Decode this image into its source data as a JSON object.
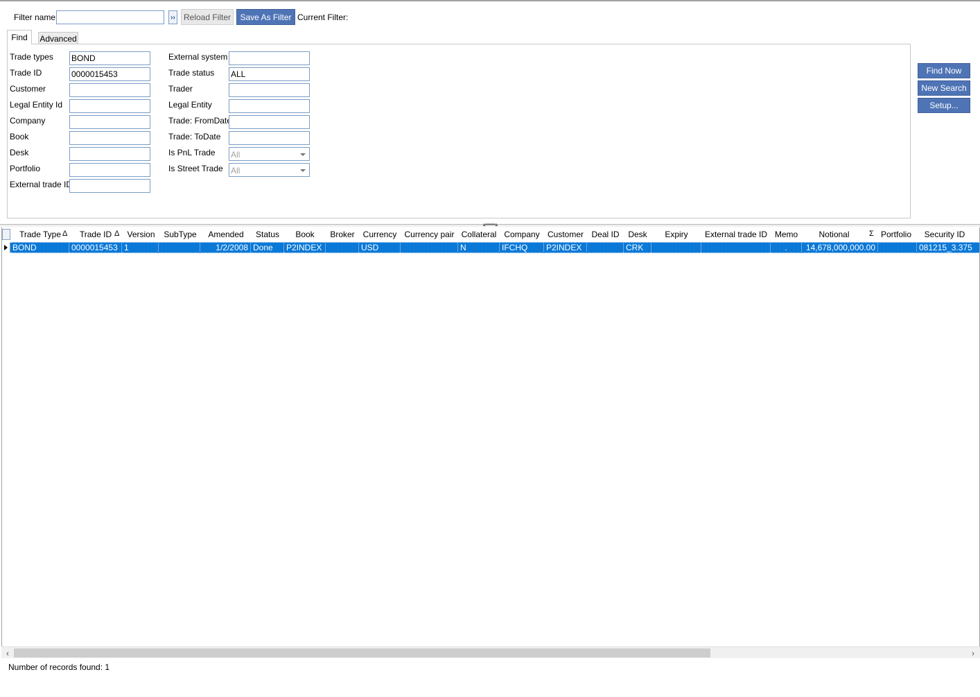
{
  "filter": {
    "name_label": "Filter name",
    "name_value": "",
    "apply_label": "››",
    "reload_label": "Reload Filter",
    "save_label": "Save As Filter",
    "current_label": "Current Filter:"
  },
  "tabs": {
    "find": "Find",
    "advanced": "Advanced"
  },
  "form": {
    "left": [
      {
        "label": "Trade types",
        "value": "BOND"
      },
      {
        "label": "Trade ID",
        "value": "0000015453"
      },
      {
        "label": "Customer",
        "value": ""
      },
      {
        "label": "Legal Entity Id",
        "value": ""
      },
      {
        "label": "Company",
        "value": ""
      },
      {
        "label": "Book",
        "value": ""
      },
      {
        "label": "Desk",
        "value": ""
      },
      {
        "label": "Portfolio",
        "value": ""
      },
      {
        "label": "External trade ID",
        "value": ""
      }
    ],
    "right": [
      {
        "label": "External system",
        "value": ""
      },
      {
        "label": "Trade status",
        "value": "ALL"
      },
      {
        "label": "Trader",
        "value": ""
      },
      {
        "label": "Legal Entity",
        "value": ""
      },
      {
        "label": "Trade: FromDate",
        "value": ""
      },
      {
        "label": "Trade: ToDate",
        "value": ""
      },
      {
        "label": "Is PnL Trade",
        "value": "All"
      },
      {
        "label": "Is Street Trade",
        "value": "All"
      }
    ]
  },
  "actions": {
    "find_now": "Find Now",
    "new_search": "New Search",
    "setup": "Setup..."
  },
  "grid": {
    "columns": [
      "Trade Type",
      "Trade ID",
      "Version",
      "SubType",
      "Amended",
      "Status",
      "Book",
      "Broker",
      "Currency",
      "Currency pair",
      "Collateral",
      "Company",
      "Customer",
      "Deal ID",
      "Desk",
      "Expiry",
      "External trade ID",
      "Memo",
      "Notional",
      "Portfolio",
      "Security ID"
    ],
    "sort_glyph": "Δ",
    "sum_glyph": "Σ",
    "row": [
      "BOND",
      "0000015453",
      "1",
      "",
      "1/2/2008",
      "Done",
      "P2INDEX",
      "",
      "USD",
      "",
      "N",
      "IFCHQ",
      "P2INDEX",
      "",
      "CRK",
      "",
      "",
      ".",
      "14,678,000,000.00",
      "",
      "081215_3.375"
    ]
  },
  "scroll": {
    "left_icon": "‹",
    "right_icon": "›"
  },
  "status": {
    "records": "Number of records found: 1"
  }
}
